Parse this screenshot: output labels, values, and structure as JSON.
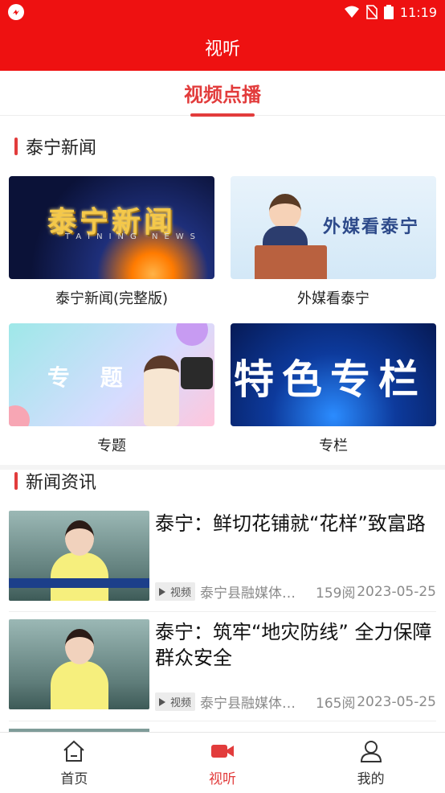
{
  "status_bar": {
    "time": "11:19",
    "app_icon": "app-logo-icon",
    "icons": [
      "wifi-icon",
      "no-sim-icon",
      "battery-icon"
    ]
  },
  "header": {
    "title": "视听"
  },
  "tabs": [
    {
      "label": "视频点播",
      "active": true
    }
  ],
  "section_program": {
    "title": "泰宁新闻",
    "tiles": [
      {
        "caption": "泰宁新闻(完整版)",
        "thumb_text": "泰宁新闻",
        "thumb_subtext": "TAINING NEWS"
      },
      {
        "caption": "外媒看泰宁",
        "thumb_text": "外媒看泰宁"
      },
      {
        "caption": "专题",
        "thumb_text": "专 题"
      },
      {
        "caption": "专栏",
        "thumb_text": "特色专栏"
      }
    ]
  },
  "section_news": {
    "title": "新闻资讯",
    "items": [
      {
        "title": "泰宁：鲜切花铺就“花样”致富路",
        "tag": "视频",
        "source": "泰宁县融媒体中心",
        "reads": "159阅",
        "date": "2023-05-25"
      },
      {
        "title": "泰宁：筑牢“地灾防线” 全力保障群众安全",
        "tag": "视频",
        "source": "泰宁县融媒体中心",
        "reads": "165阅",
        "date": "2023-05-25"
      }
    ]
  },
  "bottom_nav": [
    {
      "label": "首页",
      "icon": "home-icon",
      "active": false
    },
    {
      "label": "视听",
      "icon": "video-camera-icon",
      "active": true
    },
    {
      "label": "我的",
      "icon": "user-icon",
      "active": false
    }
  ],
  "colors": {
    "brand_red": "#ee1111",
    "accent": "#e23c3c"
  }
}
